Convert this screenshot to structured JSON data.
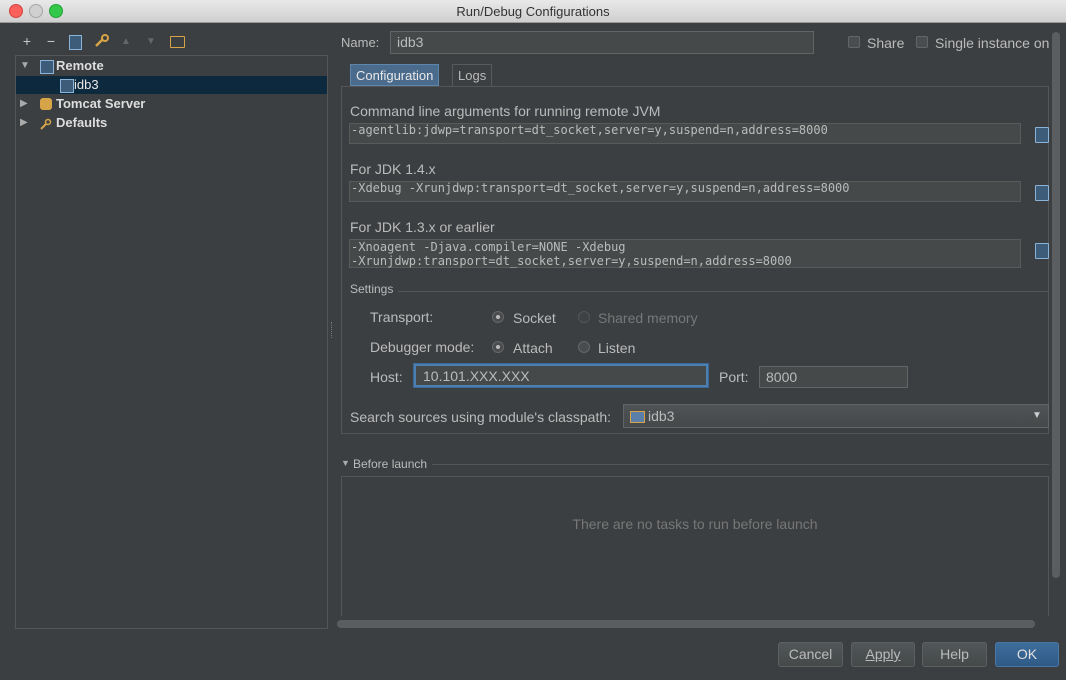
{
  "window": {
    "title": "Run/Debug Configurations"
  },
  "toolbar": {
    "add": "+",
    "remove": "−",
    "copy": "⧉",
    "edit": "🔧",
    "up": "▲",
    "down": "▼",
    "folder": "🗀"
  },
  "tree": {
    "items": [
      {
        "label": "Remote",
        "expanded": true,
        "icon": "remote-icon"
      },
      {
        "label": "idb3",
        "icon": "remote-config-icon",
        "selected": true
      },
      {
        "label": "Tomcat Server",
        "expanded": false,
        "icon": "tomcat-icon"
      },
      {
        "label": "Defaults",
        "expanded": false,
        "icon": "wrench-icon"
      }
    ]
  },
  "header": {
    "name_label": "Name:",
    "name_value": "idb3",
    "share_label": "Share",
    "single_instance_label": "Single instance only"
  },
  "tabs": [
    {
      "label": "Configuration",
      "active": true
    },
    {
      "label": "Logs",
      "active": false
    }
  ],
  "config": {
    "cmd_label": "Command line arguments for running remote JVM",
    "cmd_value": "-agentlib:jdwp=transport=dt_socket,server=y,suspend=n,address=8000",
    "jdk14_label": "For JDK 1.4.x",
    "jdk14_value": "-Xdebug -Xrunjdwp:transport=dt_socket,server=y,suspend=n,address=8000",
    "jdk13_label": "For JDK 1.3.x or earlier",
    "jdk13_line1": "-Xnoagent -Djava.compiler=NONE -Xdebug",
    "jdk13_line2": "-Xrunjdwp:transport=dt_socket,server=y,suspend=n,address=8000"
  },
  "settings": {
    "title": "Settings",
    "transport_label": "Transport:",
    "transport_socket": "Socket",
    "transport_shared": "Shared memory",
    "debugger_label": "Debugger mode:",
    "debugger_attach": "Attach",
    "debugger_listen": "Listen",
    "host_label": "Host:",
    "host_value": "10.101.XXX.XXX",
    "port_label": "Port:",
    "port_value": "8000",
    "classpath_label": "Search sources using module's classpath:",
    "classpath_value": "idb3"
  },
  "before_launch": {
    "title": "Before launch",
    "empty_text": "There are no tasks to run before launch"
  },
  "buttons": {
    "cancel": "Cancel",
    "apply": "Apply",
    "help": "Help",
    "ok": "OK"
  }
}
